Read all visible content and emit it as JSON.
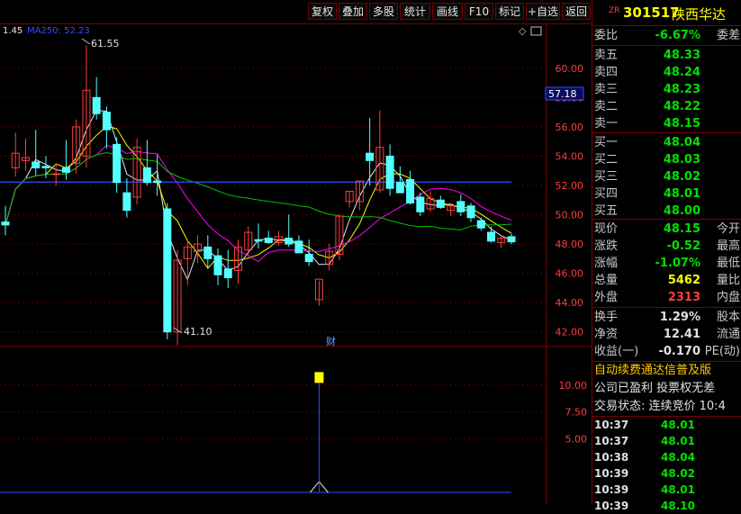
{
  "toolbar": {
    "buttons": [
      "复权",
      "叠加",
      "多股",
      "统计",
      "画线",
      "F10",
      "标记",
      "+自选",
      "返回"
    ]
  },
  "stock": {
    "tag": "ZR",
    "code": "301517",
    "name": "陕西华达"
  },
  "chart_header": {
    "ma_prefix": "1.45",
    "ma_label": "MA250: 52.23"
  },
  "annotations": {
    "high": "61.55",
    "low": "41.10",
    "current_price_tag": "57.18",
    "finance_marker": "财"
  },
  "price_axis": [
    "60.00",
    "58.00",
    "56.00",
    "54.00",
    "52.00",
    "50.00",
    "48.00",
    "46.00",
    "44.00",
    "42.00"
  ],
  "volume_axis": [
    "10.00",
    "7.50",
    "5.00"
  ],
  "colors": {
    "up": "#ff3c3c",
    "down": "#54ffff",
    "ma1": "#e6e6e6",
    "ma2": "#ffff00",
    "ma3": "#ff00ff",
    "ma4": "#00c000",
    "ma250": "#3050ff",
    "border": "#7a0000"
  },
  "chart_data": {
    "type": "candlestick",
    "ylim": [
      41,
      63
    ],
    "candles": [
      {
        "o": 49.5,
        "h": 50.6,
        "l": 48.6,
        "c": 49.3
      },
      {
        "o": 53.2,
        "h": 55.6,
        "l": 52.6,
        "c": 54.2
      },
      {
        "o": 53.7,
        "h": 55.2,
        "l": 53.0,
        "c": 53.9
      },
      {
        "o": 53.6,
        "h": 55.8,
        "l": 52.7,
        "c": 53.2
      },
      {
        "o": 53.3,
        "h": 54.0,
        "l": 52.5,
        "c": 53.2
      },
      {
        "o": 52.8,
        "h": 53.5,
        "l": 52.0,
        "c": 52.8
      },
      {
        "o": 53.2,
        "h": 55.1,
        "l": 52.4,
        "c": 52.9
      },
      {
        "o": 53.5,
        "h": 56.5,
        "l": 52.8,
        "c": 56.0
      },
      {
        "o": 54.0,
        "h": 61.55,
        "l": 53.2,
        "c": 58.5
      },
      {
        "o": 58.0,
        "h": 59.4,
        "l": 56.5,
        "c": 56.9
      },
      {
        "o": 57.0,
        "h": 57.4,
        "l": 54.5,
        "c": 55.8
      },
      {
        "o": 54.8,
        "h": 55.3,
        "l": 51.5,
        "c": 52.2
      },
      {
        "o": 51.5,
        "h": 52.5,
        "l": 49.8,
        "c": 50.3
      },
      {
        "o": 51.2,
        "h": 55.2,
        "l": 50.7,
        "c": 54.6
      },
      {
        "o": 53.2,
        "h": 55.1,
        "l": 52.0,
        "c": 52.2
      },
      {
        "o": 52.3,
        "h": 54.1,
        "l": 51.3,
        "c": 52.2
      },
      {
        "o": 50.4,
        "h": 50.8,
        "l": 41.5,
        "c": 42.0
      },
      {
        "o": 42.0,
        "h": 47.6,
        "l": 41.1,
        "c": 46.9
      },
      {
        "o": 47.0,
        "h": 48.3,
        "l": 45.2,
        "c": 47.8
      },
      {
        "o": 47.5,
        "h": 48.6,
        "l": 46.7,
        "c": 48.0
      },
      {
        "o": 47.8,
        "h": 48.6,
        "l": 46.4,
        "c": 47.0
      },
      {
        "o": 47.2,
        "h": 47.7,
        "l": 45.2,
        "c": 45.9
      },
      {
        "o": 46.3,
        "h": 47.6,
        "l": 45.0,
        "c": 45.7
      },
      {
        "o": 46.2,
        "h": 48.3,
        "l": 45.3,
        "c": 47.8
      },
      {
        "o": 47.6,
        "h": 49.2,
        "l": 47.3,
        "c": 48.8
      },
      {
        "o": 48.3,
        "h": 49.4,
        "l": 47.7,
        "c": 48.2
      },
      {
        "o": 48.4,
        "h": 48.9,
        "l": 48.0,
        "c": 48.1
      },
      {
        "o": 48.1,
        "h": 48.9,
        "l": 47.9,
        "c": 48.5
      },
      {
        "o": 48.4,
        "h": 50.0,
        "l": 47.8,
        "c": 48.0
      },
      {
        "o": 48.2,
        "h": 48.6,
        "l": 47.7,
        "c": 47.4
      },
      {
        "o": 47.3,
        "h": 48.3,
        "l": 46.5,
        "c": 46.8
      },
      {
        "o": 44.2,
        "h": 45.5,
        "l": 43.8,
        "c": 45.6
      },
      {
        "o": 46.6,
        "h": 48.0,
        "l": 46.2,
        "c": 47.5
      },
      {
        "o": 47.3,
        "h": 50.0,
        "l": 46.9,
        "c": 49.9
      },
      {
        "o": 50.9,
        "h": 51.6,
        "l": 50.5,
        "c": 51.6
      },
      {
        "o": 50.9,
        "h": 52.3,
        "l": 50.3,
        "c": 52.3
      },
      {
        "o": 54.2,
        "h": 56.6,
        "l": 52.0,
        "c": 53.7
      },
      {
        "o": 51.7,
        "h": 57.1,
        "l": 51.5,
        "c": 54.6
      },
      {
        "o": 54.0,
        "h": 54.8,
        "l": 51.3,
        "c": 51.8
      },
      {
        "o": 52.2,
        "h": 53.3,
        "l": 51.5,
        "c": 51.5
      },
      {
        "o": 52.4,
        "h": 53.0,
        "l": 50.7,
        "c": 50.8
      },
      {
        "o": 51.2,
        "h": 51.5,
        "l": 49.9,
        "c": 50.2
      },
      {
        "o": 50.4,
        "h": 51.6,
        "l": 50.2,
        "c": 51.1
      },
      {
        "o": 51.0,
        "h": 51.3,
        "l": 50.4,
        "c": 50.5
      },
      {
        "o": 50.3,
        "h": 50.7,
        "l": 49.9,
        "c": 50.6
      },
      {
        "o": 50.9,
        "h": 51.4,
        "l": 49.9,
        "c": 50.2
      },
      {
        "o": 50.6,
        "h": 50.8,
        "l": 49.5,
        "c": 49.8
      },
      {
        "o": 49.6,
        "h": 49.8,
        "l": 48.9,
        "c": 49.1
      },
      {
        "o": 48.8,
        "h": 49.2,
        "l": 48.1,
        "c": 48.2
      },
      {
        "o": 48.1,
        "h": 48.6,
        "l": 47.7,
        "c": 48.4
      },
      {
        "o": 48.5,
        "h": 48.7,
        "l": 48.0,
        "c": 48.15
      }
    ],
    "volume_indicator": {
      "ylim": [
        0,
        13
      ],
      "spike_value": 10.2,
      "spike_index": 31
    }
  },
  "quote": {
    "weibi_label": "委比",
    "weibi_value": "-6.67%",
    "weicha_label": "委差",
    "asks": [
      {
        "label": "卖五",
        "price": "48.33"
      },
      {
        "label": "卖四",
        "price": "48.24"
      },
      {
        "label": "卖三",
        "price": "48.23"
      },
      {
        "label": "卖二",
        "price": "48.22"
      },
      {
        "label": "卖一",
        "price": "48.15"
      }
    ],
    "bids": [
      {
        "label": "买一",
        "price": "48.04"
      },
      {
        "label": "买二",
        "price": "48.03"
      },
      {
        "label": "买三",
        "price": "48.02"
      },
      {
        "label": "买四",
        "price": "48.01"
      },
      {
        "label": "买五",
        "price": "48.00"
      }
    ],
    "stats": [
      {
        "label": "现价",
        "value": "48.15",
        "label2": "今开",
        "color": "#00e000"
      },
      {
        "label": "涨跌",
        "value": "-0.52",
        "label2": "最高",
        "color": "#00e000"
      },
      {
        "label": "涨幅",
        "value": "-1.07%",
        "label2": "最低",
        "color": "#00e000"
      },
      {
        "label": "总量",
        "value": "5462",
        "label2": "量比",
        "color": "#ffff00"
      },
      {
        "label": "外盘",
        "value": "2313",
        "label2": "内盘",
        "color": "#ff3c3c"
      }
    ],
    "fin": [
      {
        "label": "换手",
        "value": "1.29%",
        "label2": "股本"
      },
      {
        "label": "净资",
        "value": "12.41",
        "label2": "流通"
      },
      {
        "label": "收益(一)",
        "value": "-0.170",
        "label2": "PE(动)"
      }
    ],
    "notice": "自动续费通达信普及版",
    "info1": "公司已盈利 投票权无差",
    "info2": "交易状态: 连续竞价 10:4",
    "ticks": [
      {
        "time": "10:37",
        "price": "48.01"
      },
      {
        "time": "10:37",
        "price": "48.01"
      },
      {
        "time": "10:38",
        "price": "48.04"
      },
      {
        "time": "10:39",
        "price": "48.02"
      },
      {
        "time": "10:39",
        "price": "48.01"
      },
      {
        "time": "10:39",
        "price": "48.10"
      }
    ]
  }
}
